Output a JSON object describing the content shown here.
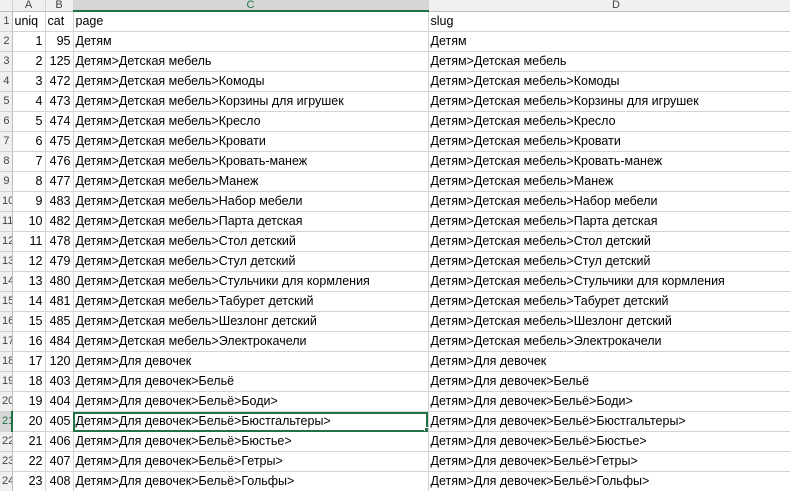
{
  "column_headers": [
    "A",
    "B",
    "C",
    "D"
  ],
  "header_row": {
    "row_label": "1",
    "cells": [
      "uniq",
      "cat",
      "page",
      "slug"
    ]
  },
  "selected_column": "C",
  "rows": [
    {
      "row_label": "2",
      "uniq": "1",
      "cat": "95",
      "page": "Детям",
      "slug": "Детям"
    },
    {
      "row_label": "3",
      "uniq": "2",
      "cat": "125",
      "page": "Детям>Детская мебель",
      "slug": "Детям>Детская мебель"
    },
    {
      "row_label": "4",
      "uniq": "3",
      "cat": "472",
      "page": "Детям>Детская мебель>Комоды",
      "slug": "Детям>Детская мебель>Комоды"
    },
    {
      "row_label": "5",
      "uniq": "4",
      "cat": "473",
      "page": "Детям>Детская мебель>Корзины для игрушек",
      "slug": "Детям>Детская мебель>Корзины для игрушек"
    },
    {
      "row_label": "6",
      "uniq": "5",
      "cat": "474",
      "page": "Детям>Детская мебель>Кресло",
      "slug": "Детям>Детская мебель>Кресло"
    },
    {
      "row_label": "7",
      "uniq": "6",
      "cat": "475",
      "page": "Детям>Детская мебель>Кровати",
      "slug": "Детям>Детская мебель>Кровати"
    },
    {
      "row_label": "8",
      "uniq": "7",
      "cat": "476",
      "page": "Детям>Детская мебель>Кровать-манеж",
      "slug": "Детям>Детская мебель>Кровать-манеж"
    },
    {
      "row_label": "9",
      "uniq": "8",
      "cat": "477",
      "page": "Детям>Детская мебель>Манеж",
      "slug": "Детям>Детская мебель>Манеж"
    },
    {
      "row_label": "10",
      "uniq": "9",
      "cat": "483",
      "page": "Детям>Детская мебель>Набор мебели",
      "slug": "Детям>Детская мебель>Набор мебели"
    },
    {
      "row_label": "11",
      "uniq": "10",
      "cat": "482",
      "page": "Детям>Детская мебель>Парта детская",
      "slug": "Детям>Детская мебель>Парта детская"
    },
    {
      "row_label": "12",
      "uniq": "11",
      "cat": "478",
      "page": "Детям>Детская мебель>Стол детский",
      "slug": "Детям>Детская мебель>Стол детский"
    },
    {
      "row_label": "13",
      "uniq": "12",
      "cat": "479",
      "page": "Детям>Детская мебель>Стул детский",
      "slug": "Детям>Детская мебель>Стул детский"
    },
    {
      "row_label": "14",
      "uniq": "13",
      "cat": "480",
      "page": "Детям>Детская мебель>Стульчики для кормления",
      "slug": "Детям>Детская мебель>Стульчики для кормления"
    },
    {
      "row_label": "15",
      "uniq": "14",
      "cat": "481",
      "page": "Детям>Детская мебель>Табурет детский",
      "slug": "Детям>Детская мебель>Табурет детский"
    },
    {
      "row_label": "16",
      "uniq": "15",
      "cat": "485",
      "page": "Детям>Детская мебель>Шезлонг детский",
      "slug": "Детям>Детская мебель>Шезлонг детский"
    },
    {
      "row_label": "17",
      "uniq": "16",
      "cat": "484",
      "page": "Детям>Детская мебель>Электрокачели",
      "slug": "Детям>Детская мебель>Электрокачели"
    },
    {
      "row_label": "18",
      "uniq": "17",
      "cat": "120",
      "page": "Детям>Для девочек",
      "slug": "Детям>Для девочек"
    },
    {
      "row_label": "19",
      "uniq": "18",
      "cat": "403",
      "page": "Детям>Для девочек>Бельё",
      "slug": "Детям>Для девочек>Бельё"
    },
    {
      "row_label": "20",
      "uniq": "19",
      "cat": "404",
      "page": "Детям>Для девочек>Бельё>Боди>",
      "slug": "Детям>Для девочек>Бельё>Боди>"
    },
    {
      "row_label": "21",
      "uniq": "20",
      "cat": "405",
      "page": "Детям>Для девочек>Бельё>Бюстгальтеры>",
      "slug": "Детям>Для девочек>Бельё>Бюстгальтеры>",
      "active": true
    },
    {
      "row_label": "22",
      "uniq": "21",
      "cat": "406",
      "page": "Детям>Для девочек>Бельё>Бюстье>",
      "slug": "Детям>Для девочек>Бельё>Бюстье>"
    },
    {
      "row_label": "23",
      "uniq": "22",
      "cat": "407",
      "page": "Детям>Для девочек>Бельё>Гетры>",
      "slug": "Детям>Для девочек>Бельё>Гетры>"
    },
    {
      "row_label": "24",
      "uniq": "23",
      "cat": "408",
      "page": "Детям>Для девочек>Бельё>Гольфы>",
      "slug": "Детям>Для девочек>Бельё>Гольфы>"
    }
  ],
  "colors": {
    "selection": "#217346",
    "header_bg": "#f0f0f0",
    "gridline": "#d4d4d4"
  }
}
